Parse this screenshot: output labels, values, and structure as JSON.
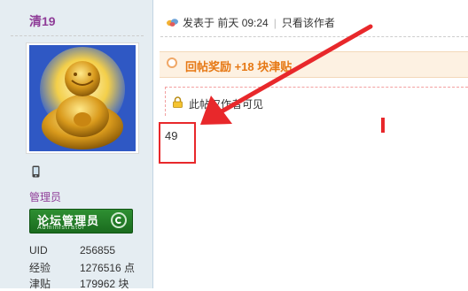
{
  "user": {
    "name": "清19",
    "role": "管理员",
    "badge": {
      "title": "论坛管理员",
      "subtitle": "Administrator"
    },
    "stats": [
      {
        "label": "UID",
        "value": "256855"
      },
      {
        "label": "经验",
        "value": "1276516 点"
      },
      {
        "label": "津贴",
        "value": "179962 块"
      }
    ]
  },
  "post": {
    "posted_prefix": "发表于",
    "posted_time": "前天 09:24",
    "only_author": "只看该作者",
    "reward": "回帖奖励 +18 块津贴",
    "locked_notice": "此帖仅作者可见",
    "body": "49"
  },
  "colors": {
    "sidebar_bg": "#e5edf2",
    "username": "#8f3d98",
    "reward_text": "#e67814",
    "annotation_red": "#e8282b",
    "badge_green": "#2e8f32"
  }
}
